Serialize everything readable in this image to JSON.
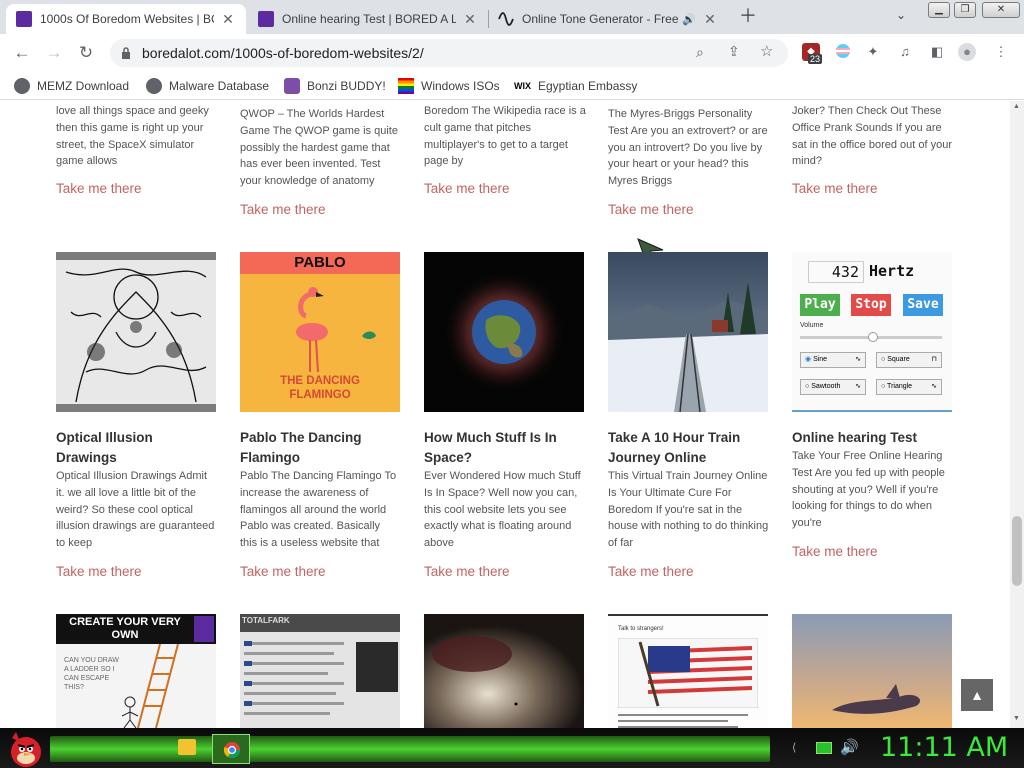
{
  "tabs": [
    {
      "title": "1000s Of Boredom Websites | BC",
      "active": true,
      "icon": "boredalot-favicon"
    },
    {
      "title": "Online hearing Test | BORED A LO",
      "active": false,
      "icon": "boredalot-favicon"
    },
    {
      "title": "Online Tone Generator - Free",
      "active": false,
      "icon": "tone-wave-favicon"
    }
  ],
  "address_bar": {
    "url": "boredalot.com/1000s-of-boredom-websites/2/"
  },
  "bookmarks": [
    {
      "label": "MEMZ Download",
      "icon": "globe-icon"
    },
    {
      "label": "Malware Database",
      "icon": "globe-icon"
    },
    {
      "label": "Bonzi BUDDY!",
      "icon": "bonzi-icon"
    },
    {
      "label": "Windows ISOs",
      "icon": "windows-icon"
    },
    {
      "label": "Egyptian Embassy",
      "icon": "wix-icon"
    }
  ],
  "extension_badge": "23",
  "top_cards": [
    {
      "excerpt": "love all things space and geeky then this game is right up your street, the SpaceX simulator game allows",
      "link": "Take me there"
    },
    {
      "excerpt": "QWOP – The Worlds Hardest Game The QWOP  game is quite possibly the hardest game that has ever been invented. Test your knowledge of anatomy",
      "link": "Take me there"
    },
    {
      "excerpt": "Boredom   The Wikipedia race is a cult game that pitches multiplayer's to get to a target page by",
      "link": "Take me there"
    },
    {
      "excerpt": "The Myres-Briggs Personality Test Are you an extrovert? or are  you an introvert? Do you live by your heart or your head? this Myres Briggs",
      "link": "Take me there"
    },
    {
      "excerpt": "Joker? Then Check Out These Office Prank Sounds If you are sat in the office bored out of your mind?",
      "link": "Take me there"
    }
  ],
  "cards": [
    {
      "title": "Optical Illusion Drawings",
      "excerpt": "Optical Illusion Drawings Admit it. we all love a little bit of the weird? So these cool optical illusion drawings are guaranteed to keep",
      "link": "Take me there",
      "thumb": "sketch"
    },
    {
      "title": "Pablo The Dancing Flamingo",
      "excerpt": "Pablo The Dancing Flamingo To increase the awareness of flamingos all around the world Pablo was created. Basically this is a useless website that",
      "link": "Take me there",
      "thumb": "flamingo"
    },
    {
      "title": "How Much Stuff Is In Space?",
      "excerpt": "Ever Wondered How much Stuff Is In Space?   Well now you can, this cool website lets you see exactly what is floating around above",
      "link": "Take me there",
      "thumb": "space"
    },
    {
      "title": "Take A 10 Hour Train Journey Online",
      "excerpt": "This Virtual Train Journey Online Is Your Ultimate Cure For Boredom   If you're sat in the house with nothing to do thinking of far",
      "link": "Take me there",
      "thumb": "train"
    },
    {
      "title": "Online hearing Test",
      "excerpt": "Take Your Free Online Hearing Test Are you fed up with people shouting at you? Well if you're looking for things to do when you're",
      "link": "Take me there",
      "thumb": "tone"
    }
  ],
  "flamingo_thumb": {
    "top_text": "PABLO",
    "bottom_text": "THE DANCING FLAMINGO"
  },
  "tone_thumb": {
    "frequency": "432",
    "unit": "Hertz",
    "play": "Play",
    "stop": "Stop",
    "save": "Save",
    "volume": "Volume",
    "waves": [
      "Sine",
      "Square",
      "Sawtooth",
      "Triangle"
    ]
  },
  "bottom_thumbs": [
    {
      "kind": "ladder",
      "heading": "CREATE YOUR VERY OWN",
      "caption": "CAN YOU DRAW A LADDER SO I CAN ESCAPE THIS?"
    },
    {
      "kind": "totalfark",
      "brand": "TOTALFARK"
    },
    {
      "kind": "blur"
    },
    {
      "kind": "flag",
      "heading": "Talk to strangers!"
    },
    {
      "kind": "sunset"
    }
  ],
  "taskbar": {
    "clock": "11:11 AM"
  },
  "colors": {
    "link": "#c26364",
    "clock": "#3ce83c",
    "taskbar_green": "#4cd030"
  }
}
